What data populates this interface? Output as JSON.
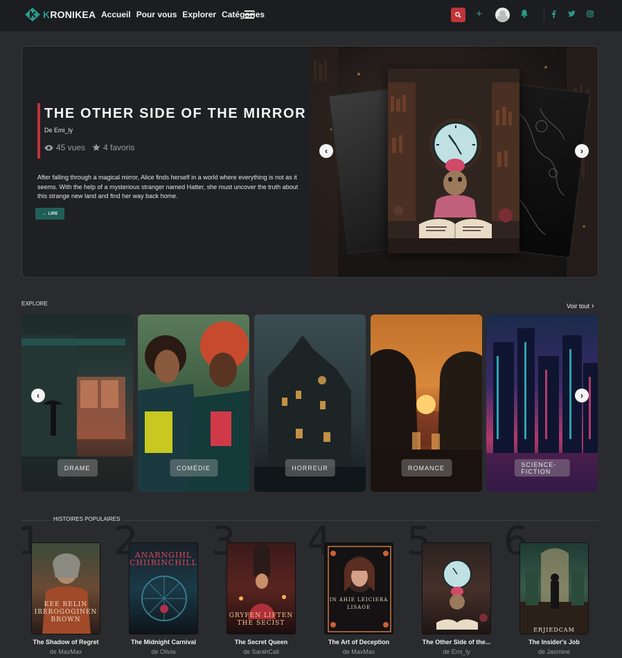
{
  "nav": {
    "logo_text": "KRONIKEA",
    "logo_first": "K",
    "logo_rest": "RONIKEA",
    "menu": [
      "Accueil",
      "Pour vous",
      "Explorer",
      "Catégories"
    ],
    "colors": {
      "accent": "#2b9a8a",
      "danger": "#c0343a"
    },
    "icons": [
      "search-icon",
      "plus-icon",
      "avatar",
      "bell-icon",
      "facebook-icon",
      "twitter-icon",
      "instagram-icon"
    ]
  },
  "hero": {
    "title": "THE OTHER SIDE OF THE MIRROR",
    "author": "De Emi_ly",
    "views": "45 vues",
    "favs": "4 favoris",
    "description": "After falling through a magical mirror, Alice finds herself in a world where everything is not as it seems. With the help of a mysterious stranger named Hatter, she must uncover the truth about this strange new land and find her way back home.",
    "read_label": "LIRE"
  },
  "explore": {
    "heading": "EXPLORE",
    "see_all": "Voir tout",
    "categories": [
      "DRAME",
      "COMÉDIE",
      "HORREUR",
      "ROMANCE",
      "SCIENCE-FICTION"
    ]
  },
  "popular": {
    "heading": "HISTOIRES POPULAIRES",
    "books": [
      {
        "rank": "1",
        "title": "The Shadow of Regret",
        "author": "de MaxMax",
        "cover_text": "KEE RELIN IREROGOGINEN BROWN"
      },
      {
        "rank": "2",
        "title": "The Midnight Carnival",
        "author": "de Olivia",
        "cover_text": "ANARNGIHL CHIIRINCHILL"
      },
      {
        "rank": "3",
        "title": "The Secret Queen",
        "author": "de SarahCali",
        "cover_text": "GRYFEN LIFTEN THE SECIST"
      },
      {
        "rank": "4",
        "title": "The Art of Deception",
        "author": "de MaxMax",
        "cover_text": "IN AHIE LEICIERA LISAOE"
      },
      {
        "rank": "5",
        "title": "The Other Side of the...",
        "author": "de Emi_ly",
        "cover_text": ""
      },
      {
        "rank": "6",
        "title": "The Insider's Job",
        "author": "de Jasmine",
        "cover_text": "ERJIEDCAM"
      }
    ]
  }
}
